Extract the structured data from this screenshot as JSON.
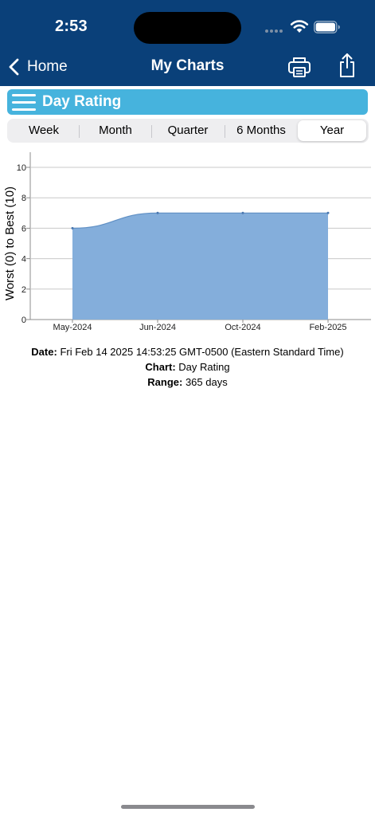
{
  "status_bar": {
    "time": "2:53"
  },
  "nav": {
    "back_label": "Home",
    "title": "My Charts"
  },
  "header": {
    "title": "Day Rating"
  },
  "segments": [
    {
      "label": "Week",
      "selected": false
    },
    {
      "label": "Month",
      "selected": false
    },
    {
      "label": "Quarter",
      "selected": false
    },
    {
      "label": "6 Months",
      "selected": false
    },
    {
      "label": "Year",
      "selected": true
    }
  ],
  "chart_data": {
    "type": "area",
    "title": "",
    "ylabel": "Worst (0) to Best (10)",
    "xlabel": "",
    "ylim": [
      0,
      10
    ],
    "yticks": [
      0,
      2,
      4,
      6,
      8,
      10
    ],
    "x": [
      "May-2024",
      "Jun-2024",
      "Oct-2024",
      "Feb-2025"
    ],
    "values": [
      6,
      7,
      7,
      7
    ],
    "grid": true,
    "fill_color": "#84aedb",
    "line_color": "#5f8fc4"
  },
  "info": {
    "date_label": "Date:",
    "date_value": "Fri Feb 14 2025 14:53:25 GMT-0500 (Eastern Standard Time)",
    "chart_label": "Chart:",
    "chart_value": "Day Rating",
    "range_label": "Range:",
    "range_value": "365 days"
  },
  "colors": {
    "nav_background": "#0a4079",
    "header_background": "#46b3dd",
    "segment_background": "#eeeef0"
  }
}
